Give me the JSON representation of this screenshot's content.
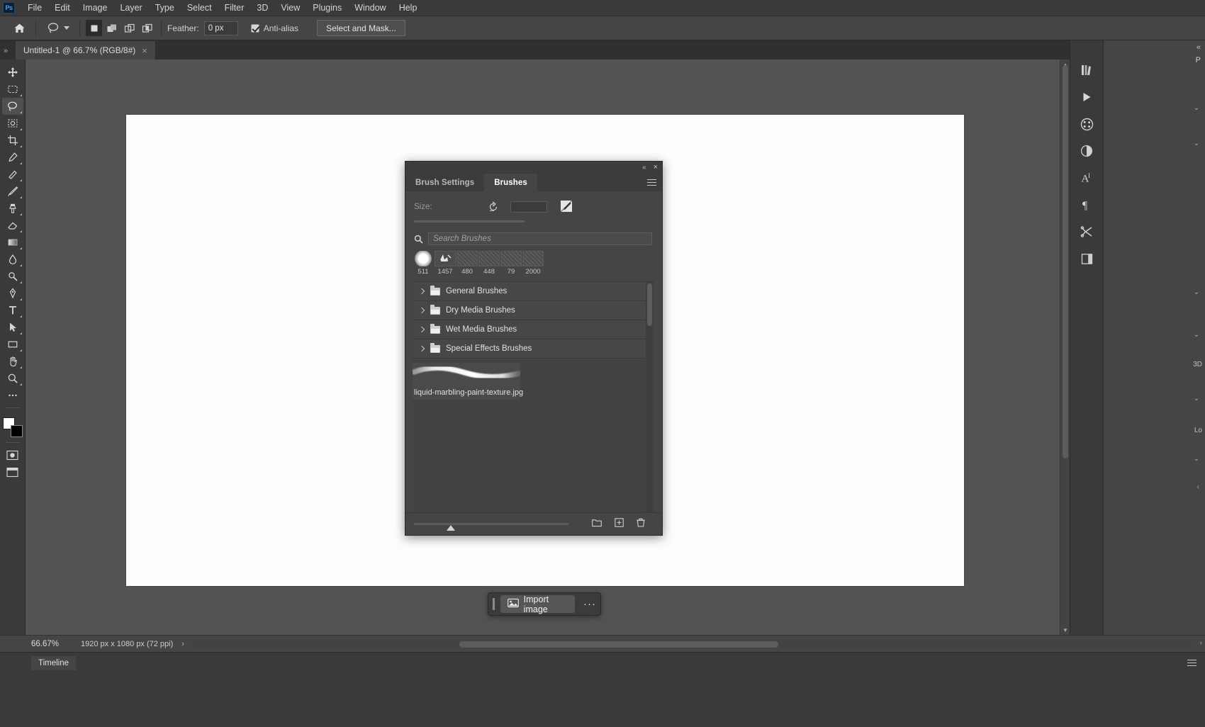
{
  "app": {
    "name": "Adobe Photoshop",
    "logo_text": "Ps"
  },
  "menubar": {
    "items": [
      {
        "label": "File"
      },
      {
        "label": "Edit"
      },
      {
        "label": "Image"
      },
      {
        "label": "Layer"
      },
      {
        "label": "Type"
      },
      {
        "label": "Select"
      },
      {
        "label": "Filter"
      },
      {
        "label": "3D"
      },
      {
        "label": "View"
      },
      {
        "label": "Plugins"
      },
      {
        "label": "Window"
      },
      {
        "label": "Help"
      }
    ]
  },
  "options_bar": {
    "home_icon": "home-icon",
    "active_tool_icon": "lasso-icon",
    "selection_modes": [
      "new-selection",
      "add-to-selection",
      "subtract-from-selection",
      "intersect-with-selection"
    ],
    "feather_label": "Feather:",
    "feather_value": "0 px",
    "antialias_label": "Anti-alias",
    "antialias_checked": true,
    "select_and_mask_label": "Select and Mask..."
  },
  "document_tabs": {
    "collapse_glyph": "»",
    "tabs": [
      {
        "title": "Untitled-1 @ 66.7% (RGB/8#)",
        "close_glyph": "×"
      }
    ]
  },
  "toolbar": {
    "tools": [
      {
        "name": "move-tool"
      },
      {
        "name": "rectangular-marquee-tool"
      },
      {
        "name": "lasso-tool",
        "active": true
      },
      {
        "name": "object-selection-tool"
      },
      {
        "name": "crop-tool"
      },
      {
        "name": "eyedropper-tool"
      },
      {
        "name": "spot-healing-brush-tool"
      },
      {
        "name": "brush-tool"
      },
      {
        "name": "clone-stamp-tool"
      },
      {
        "name": "eraser-tool"
      },
      {
        "name": "gradient-tool"
      },
      {
        "name": "blur-tool"
      },
      {
        "name": "dodge-tool"
      },
      {
        "name": "pen-tool"
      },
      {
        "name": "type-tool"
      },
      {
        "name": "path-selection-tool"
      },
      {
        "name": "rectangle-tool"
      },
      {
        "name": "hand-tool"
      },
      {
        "name": "zoom-tool"
      },
      {
        "name": "edit-toolbar-tool"
      }
    ],
    "foreground_color": "#ffffff",
    "background_color": "#000000"
  },
  "brush_panel": {
    "collapse_glyph": "«",
    "close_glyph": "×",
    "tabs": [
      {
        "label": "Brush Settings",
        "active": false
      },
      {
        "label": "Brushes",
        "active": true
      }
    ],
    "menu_icon": "panel-menu-icon",
    "size_label": "Size:",
    "size_value": "",
    "reset_icon": "reset-icon",
    "brush_tip_icon": "brush-tip-icon",
    "search": {
      "icon": "search-icon",
      "placeholder": "Search Brushes",
      "value": ""
    },
    "presets": [
      {
        "label": "511",
        "thumb": "soft-round"
      },
      {
        "label": "1457",
        "thumb": "splatter"
      },
      {
        "label": "480",
        "thumb": "texture"
      },
      {
        "label": "448",
        "thumb": "texture"
      },
      {
        "label": "79",
        "thumb": "texture"
      },
      {
        "label": "2000",
        "thumb": "texture"
      }
    ],
    "folders": [
      {
        "label": "General Brushes",
        "expanded": false,
        "icon": "folder-icon"
      },
      {
        "label": "Dry Media Brushes",
        "expanded": false,
        "icon": "folder-icon"
      },
      {
        "label": "Wet Media Brushes",
        "expanded": false,
        "icon": "folder-icon"
      },
      {
        "label": "Special Effects Brushes",
        "expanded": false,
        "icon": "folder-icon"
      }
    ],
    "imported_brush": {
      "label": "liquid-marbling-paint-texture.jpg",
      "preview": "brush-stroke-preview"
    },
    "footer": {
      "slider_name": "brush-size-slider",
      "icons": [
        {
          "name": "new-group-icon"
        },
        {
          "name": "new-brush-icon"
        },
        {
          "name": "delete-brush-icon"
        }
      ]
    }
  },
  "import_toolbar": {
    "grip": "drag-handle",
    "icon": "import-image-icon",
    "label": "Import image",
    "more_label": "···"
  },
  "right_dock": {
    "collapse_glyph": "«",
    "panel_label": "P",
    "icons": [
      {
        "name": "libraries-icon"
      },
      {
        "name": "actions-icon"
      },
      {
        "name": "color-wheel-icon"
      },
      {
        "name": "adjustments-icon"
      },
      {
        "name": "character-icon"
      },
      {
        "name": "paragraph-icon"
      },
      {
        "name": "tools-icon"
      },
      {
        "name": "layer-comps-icon"
      }
    ],
    "side_labels": [
      "3D",
      "Lo"
    ]
  },
  "status_bar": {
    "zoom": "66.67%",
    "doc_info": "1920 px x 1080 px (72 ppi)",
    "next_glyph": "›",
    "prev_glyph": "‹",
    "right_glyph": "›"
  },
  "timeline": {
    "tab_label": "Timeline",
    "menu_icon": "panel-menu-icon"
  },
  "colors": {
    "panel_bg": "#454545",
    "chrome_bg": "#3a3a3a",
    "canvas_bg": "#535353",
    "artboard": "#fdfdfb",
    "accent": "#3fa0e8"
  }
}
